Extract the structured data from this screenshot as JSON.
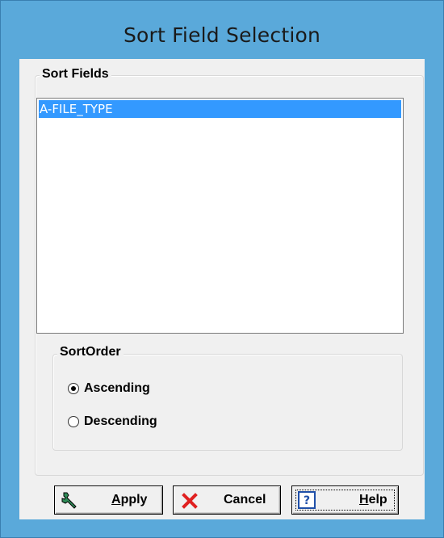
{
  "window": {
    "title": "Sort Field Selection"
  },
  "sort_fields": {
    "group_label": "Sort Fields",
    "items": [
      "A-FILE_TYPE"
    ],
    "selected_index": 0
  },
  "sort_order": {
    "group_label": "SortOrder",
    "options": [
      {
        "label": "Ascending",
        "checked": true
      },
      {
        "label": "Descending",
        "checked": false
      }
    ]
  },
  "buttons": {
    "apply": {
      "mnemonic": "A",
      "rest": "pply",
      "icon": "wrench-icon"
    },
    "cancel": {
      "label": "Cancel",
      "icon": "red-x-icon"
    },
    "help": {
      "mnemonic": "H",
      "rest": "elp",
      "icon": "question-icon"
    }
  },
  "colors": {
    "frame": "#5aa9da",
    "selection": "#3399ff",
    "apply_icon": "#2e8b57",
    "cancel_icon": "#e02020",
    "help_icon": "#1f4fa8"
  }
}
